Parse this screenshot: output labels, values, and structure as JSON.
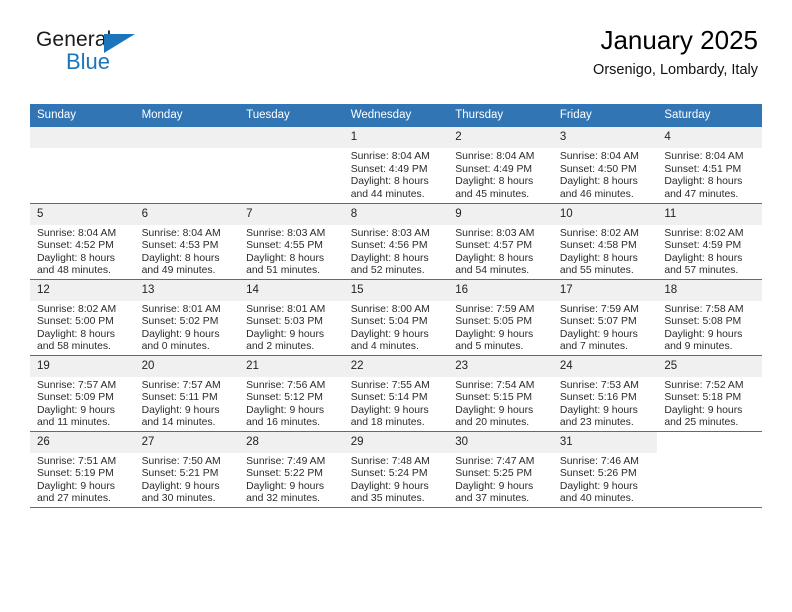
{
  "brand": {
    "name_top": "General",
    "name_bottom": "Blue"
  },
  "header": {
    "title": "January 2025",
    "location": "Orsenigo, Lombardy, Italy"
  },
  "weekday_headers": [
    "Sunday",
    "Monday",
    "Tuesday",
    "Wednesday",
    "Thursday",
    "Friday",
    "Saturday"
  ],
  "colors": {
    "header_blue": "#3175b4",
    "brand_blue": "#1b75bb",
    "daynum_bg": "#f0f0f0"
  },
  "weeks": [
    [
      {
        "day": "",
        "lines": [],
        "blank": true
      },
      {
        "day": "",
        "lines": [],
        "blank": true
      },
      {
        "day": "",
        "lines": [],
        "blank": true
      },
      {
        "day": "1",
        "lines": [
          "Sunrise: 8:04 AM",
          "Sunset: 4:49 PM",
          "Daylight: 8 hours",
          "and 44 minutes."
        ]
      },
      {
        "day": "2",
        "lines": [
          "Sunrise: 8:04 AM",
          "Sunset: 4:49 PM",
          "Daylight: 8 hours",
          "and 45 minutes."
        ]
      },
      {
        "day": "3",
        "lines": [
          "Sunrise: 8:04 AM",
          "Sunset: 4:50 PM",
          "Daylight: 8 hours",
          "and 46 minutes."
        ]
      },
      {
        "day": "4",
        "lines": [
          "Sunrise: 8:04 AM",
          "Sunset: 4:51 PM",
          "Daylight: 8 hours",
          "and 47 minutes."
        ]
      }
    ],
    [
      {
        "day": "5",
        "lines": [
          "Sunrise: 8:04 AM",
          "Sunset: 4:52 PM",
          "Daylight: 8 hours",
          "and 48 minutes."
        ]
      },
      {
        "day": "6",
        "lines": [
          "Sunrise: 8:04 AM",
          "Sunset: 4:53 PM",
          "Daylight: 8 hours",
          "and 49 minutes."
        ]
      },
      {
        "day": "7",
        "lines": [
          "Sunrise: 8:03 AM",
          "Sunset: 4:55 PM",
          "Daylight: 8 hours",
          "and 51 minutes."
        ]
      },
      {
        "day": "8",
        "lines": [
          "Sunrise: 8:03 AM",
          "Sunset: 4:56 PM",
          "Daylight: 8 hours",
          "and 52 minutes."
        ]
      },
      {
        "day": "9",
        "lines": [
          "Sunrise: 8:03 AM",
          "Sunset: 4:57 PM",
          "Daylight: 8 hours",
          "and 54 minutes."
        ]
      },
      {
        "day": "10",
        "lines": [
          "Sunrise: 8:02 AM",
          "Sunset: 4:58 PM",
          "Daylight: 8 hours",
          "and 55 minutes."
        ]
      },
      {
        "day": "11",
        "lines": [
          "Sunrise: 8:02 AM",
          "Sunset: 4:59 PM",
          "Daylight: 8 hours",
          "and 57 minutes."
        ]
      }
    ],
    [
      {
        "day": "12",
        "lines": [
          "Sunrise: 8:02 AM",
          "Sunset: 5:00 PM",
          "Daylight: 8 hours",
          "and 58 minutes."
        ]
      },
      {
        "day": "13",
        "lines": [
          "Sunrise: 8:01 AM",
          "Sunset: 5:02 PM",
          "Daylight: 9 hours",
          "and 0 minutes."
        ]
      },
      {
        "day": "14",
        "lines": [
          "Sunrise: 8:01 AM",
          "Sunset: 5:03 PM",
          "Daylight: 9 hours",
          "and 2 minutes."
        ]
      },
      {
        "day": "15",
        "lines": [
          "Sunrise: 8:00 AM",
          "Sunset: 5:04 PM",
          "Daylight: 9 hours",
          "and 4 minutes."
        ]
      },
      {
        "day": "16",
        "lines": [
          "Sunrise: 7:59 AM",
          "Sunset: 5:05 PM",
          "Daylight: 9 hours",
          "and 5 minutes."
        ]
      },
      {
        "day": "17",
        "lines": [
          "Sunrise: 7:59 AM",
          "Sunset: 5:07 PM",
          "Daylight: 9 hours",
          "and 7 minutes."
        ]
      },
      {
        "day": "18",
        "lines": [
          "Sunrise: 7:58 AM",
          "Sunset: 5:08 PM",
          "Daylight: 9 hours",
          "and 9 minutes."
        ]
      }
    ],
    [
      {
        "day": "19",
        "lines": [
          "Sunrise: 7:57 AM",
          "Sunset: 5:09 PM",
          "Daylight: 9 hours",
          "and 11 minutes."
        ]
      },
      {
        "day": "20",
        "lines": [
          "Sunrise: 7:57 AM",
          "Sunset: 5:11 PM",
          "Daylight: 9 hours",
          "and 14 minutes."
        ]
      },
      {
        "day": "21",
        "lines": [
          "Sunrise: 7:56 AM",
          "Sunset: 5:12 PM",
          "Daylight: 9 hours",
          "and 16 minutes."
        ]
      },
      {
        "day": "22",
        "lines": [
          "Sunrise: 7:55 AM",
          "Sunset: 5:14 PM",
          "Daylight: 9 hours",
          "and 18 minutes."
        ]
      },
      {
        "day": "23",
        "lines": [
          "Sunrise: 7:54 AM",
          "Sunset: 5:15 PM",
          "Daylight: 9 hours",
          "and 20 minutes."
        ]
      },
      {
        "day": "24",
        "lines": [
          "Sunrise: 7:53 AM",
          "Sunset: 5:16 PM",
          "Daylight: 9 hours",
          "and 23 minutes."
        ]
      },
      {
        "day": "25",
        "lines": [
          "Sunrise: 7:52 AM",
          "Sunset: 5:18 PM",
          "Daylight: 9 hours",
          "and 25 minutes."
        ]
      }
    ],
    [
      {
        "day": "26",
        "lines": [
          "Sunrise: 7:51 AM",
          "Sunset: 5:19 PM",
          "Daylight: 9 hours",
          "and 27 minutes."
        ]
      },
      {
        "day": "27",
        "lines": [
          "Sunrise: 7:50 AM",
          "Sunset: 5:21 PM",
          "Daylight: 9 hours",
          "and 30 minutes."
        ]
      },
      {
        "day": "28",
        "lines": [
          "Sunrise: 7:49 AM",
          "Sunset: 5:22 PM",
          "Daylight: 9 hours",
          "and 32 minutes."
        ]
      },
      {
        "day": "29",
        "lines": [
          "Sunrise: 7:48 AM",
          "Sunset: 5:24 PM",
          "Daylight: 9 hours",
          "and 35 minutes."
        ]
      },
      {
        "day": "30",
        "lines": [
          "Sunrise: 7:47 AM",
          "Sunset: 5:25 PM",
          "Daylight: 9 hours",
          "and 37 minutes."
        ]
      },
      {
        "day": "31",
        "lines": [
          "Sunrise: 7:46 AM",
          "Sunset: 5:26 PM",
          "Daylight: 9 hours",
          "and 40 minutes."
        ]
      },
      {
        "day": "",
        "lines": [],
        "blank": true,
        "no_strip": true
      }
    ]
  ]
}
